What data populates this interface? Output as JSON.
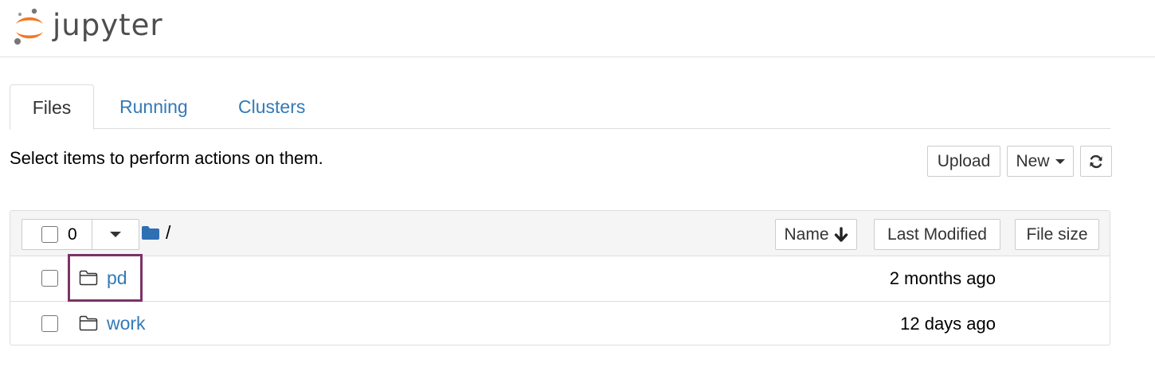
{
  "app": {
    "logo_text": "jupyter"
  },
  "tabs": [
    {
      "label": "Files",
      "active": true
    },
    {
      "label": "Running",
      "active": false
    },
    {
      "label": "Clusters",
      "active": false
    }
  ],
  "toolbar": {
    "hint": "Select items to perform actions on them.",
    "upload_label": "Upload",
    "new_label": "New",
    "refresh_icon": "refresh-icon"
  },
  "file_list": {
    "selected_count": "0",
    "breadcrumb_path": "/",
    "columns": {
      "name": "Name",
      "last_modified": "Last Modified",
      "file_size": "File size"
    },
    "rows": [
      {
        "name": "pd",
        "type": "folder",
        "last_modified": "2 months ago",
        "highlighted": true
      },
      {
        "name": "work",
        "type": "folder",
        "last_modified": "12 days ago",
        "highlighted": false
      }
    ]
  },
  "colors": {
    "link": "#337ab7",
    "highlight_border": "#7a3468",
    "logo_orange": "#f37726",
    "logo_gray": "#767677",
    "folder_blue": "#2f6fb3"
  }
}
